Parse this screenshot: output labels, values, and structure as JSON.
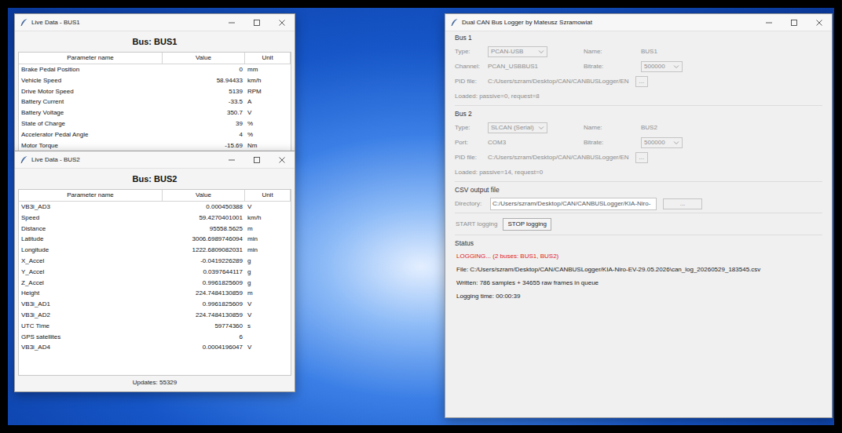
{
  "live_windows": [
    {
      "title": "Live Data - BUS1",
      "heading": "Bus: BUS1",
      "columns": [
        "Parameter name",
        "Value",
        "Unit"
      ],
      "rows": [
        [
          "Brake Pedal Position",
          "0",
          "mm"
        ],
        [
          "Vehicle Speed",
          "58.94433",
          "km/h"
        ],
        [
          "Drive Motor Speed",
          "5139",
          "RPM"
        ],
        [
          "Battery Current",
          "-33.5",
          "A"
        ],
        [
          "Battery Voltage",
          "350.7",
          "V"
        ],
        [
          "State of Charge",
          "39",
          "%"
        ],
        [
          "Accelerator Pedal Angle",
          "4",
          "%"
        ],
        [
          "Motor Torque",
          "-15.69",
          "Nm"
        ]
      ]
    },
    {
      "title": "Live Data - BUS2",
      "heading": "Bus: BUS2",
      "columns": [
        "Parameter name",
        "Value",
        "Unit"
      ],
      "rows": [
        [
          "VB3i_AD3",
          "0.000450388",
          "V"
        ],
        [
          "Speed",
          "59.4270401001",
          "km/h"
        ],
        [
          "Distance",
          "95558.5625",
          "m"
        ],
        [
          "Latitude",
          "3006.6989746094",
          "min"
        ],
        [
          "Longitude",
          "1222.6809082031",
          "min"
        ],
        [
          "X_Accel",
          "-0.0419226289",
          "g"
        ],
        [
          "Y_Accel",
          "0.0397644117",
          "g"
        ],
        [
          "Z_Accel",
          "0.9961825609",
          "g"
        ],
        [
          "Height",
          "224.7484130859",
          "m"
        ],
        [
          "VB3i_AD1",
          "0.9961825609",
          "V"
        ],
        [
          "VB3i_AD2",
          "224.7484130859",
          "V"
        ],
        [
          "UTC Time",
          "59774360",
          "s"
        ],
        [
          "GPS satellites",
          "6",
          ""
        ],
        [
          "VB3i_AD4",
          "0.0004196047",
          "V"
        ]
      ],
      "footer": "Updates: 55329"
    }
  ],
  "logger": {
    "title": "Dual CAN Bus Logger by Mateusz Szramowiat",
    "buses": [
      {
        "legend": "Bus 1",
        "disabled": true,
        "type_label": "Type:",
        "type_value": "PCAN-USB",
        "name_label": "Name:",
        "name_value": "BUS1",
        "port_label": "Channel:",
        "port_value": "PCAN_USBBUS1",
        "bitrate_label": "Bitrate:",
        "bitrate_value": "500000",
        "pid_label": "PID file:",
        "pid_value": "C:/Users/szram/Desktop/CAN/CANBUSLogger/EN",
        "browse": "...",
        "loaded": "Loaded: passive=0, request=8"
      },
      {
        "legend": "Bus 2",
        "disabled": true,
        "type_label": "Type:",
        "type_value": "SLCAN (Serial)",
        "name_label": "Name:",
        "name_value": "BUS2",
        "port_label": "Port:",
        "port_value": "COM3",
        "bitrate_label": "Bitrate:",
        "bitrate_value": "500000",
        "pid_label": "PID file:",
        "pid_value": "C:/Users/szram/Desktop/CAN/CANBUSLogger/EN",
        "browse": "...",
        "loaded": "Loaded: passive=14, request=0"
      }
    ],
    "csv": {
      "legend": "CSV output file",
      "disabled": true,
      "dir_label": "Directory:",
      "dir_value": "C:/Users/szram/Desktop/CAN/CANBUSLogger/KIA-Niro-",
      "browse": "..."
    },
    "buttons": [
      {
        "label": "START logging",
        "disabled": true
      },
      {
        "label": "STOP logging",
        "disabled": false
      }
    ],
    "status": {
      "legend": "Status",
      "state": "LOGGING... (2 buses: BUS1, BUS2)",
      "file": "File: C:/Users/szram/Desktop/CAN/CANBUSLogger/KIA-Niro-EV-29.05.2026\\can_log_20260529_183545.csv",
      "written": "Written: 786 samples + 34655 raw frames in queue",
      "time": "Logging time: 00:00:39"
    }
  }
}
